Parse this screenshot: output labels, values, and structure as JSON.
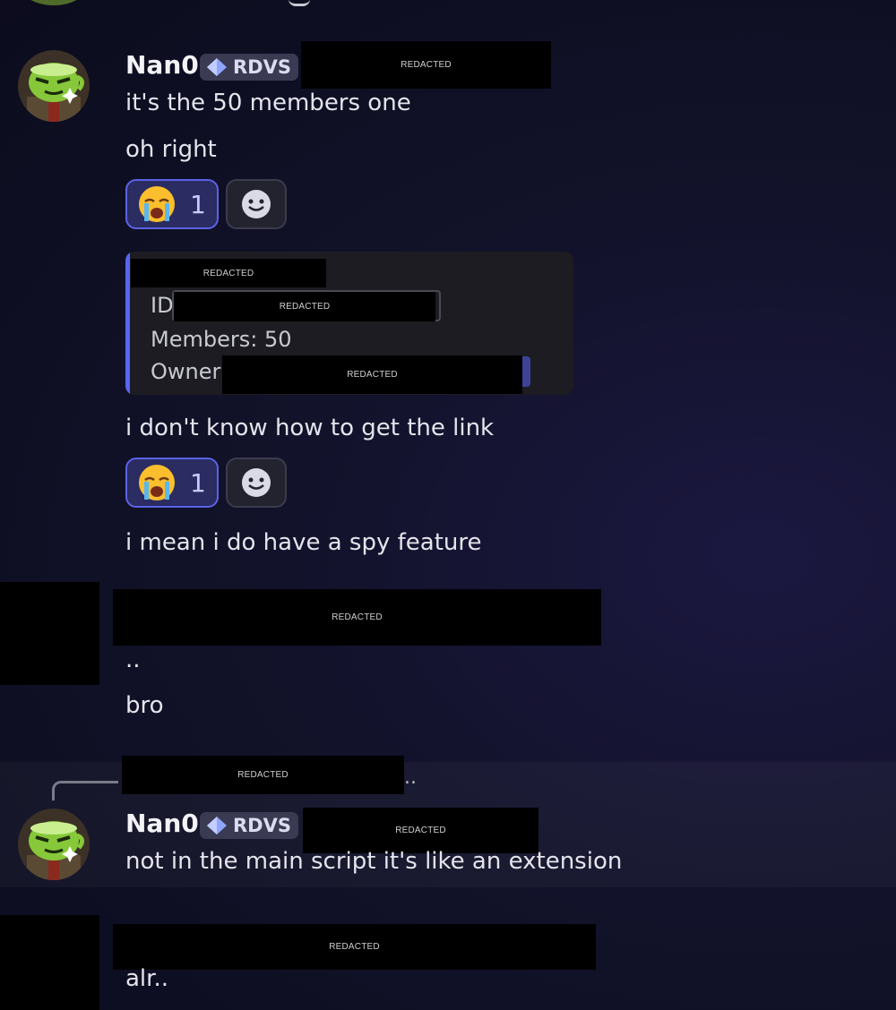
{
  "redacted_label": "REDACTED",
  "user1": {
    "name": "Nan0",
    "tag": "RDVS"
  },
  "messages": {
    "m1": "it's the 50 members one",
    "m2": "oh right",
    "m3": "i don't know how to get the link",
    "m4": "i mean i do have a spy feature",
    "m5": "..",
    "m6": "bro",
    "m7": "not in the main script it's like an extension",
    "m8": "alr.."
  },
  "reactions": {
    "emoji": "😭",
    "count": "1"
  },
  "embed": {
    "id_label": "ID",
    "members_label": "Members: 50",
    "owner_label": "Owner"
  },
  "reply_ellipsis": "..",
  "colors": {
    "accent": "#5865f2",
    "background": "#12122a"
  }
}
